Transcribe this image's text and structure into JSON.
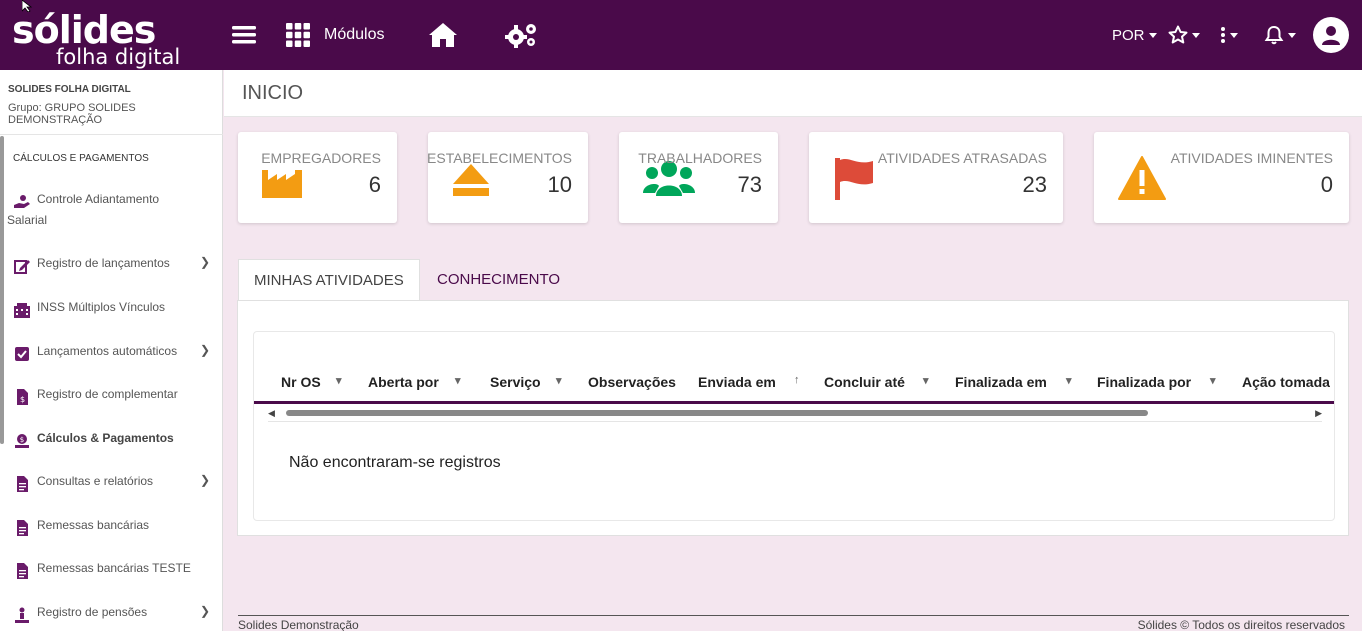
{
  "topbar": {
    "logo_main": "sólides",
    "logo_sub": "folha digital",
    "modules_label": "Módulos",
    "language": "POR"
  },
  "sidebar": {
    "title": "SOLIDES FOLHA DIGITAL",
    "group": "Grupo: GRUPO SOLIDES DEMONSTRAÇÃO",
    "section": "CÁLCULOS E PAGAMENTOS",
    "items": [
      {
        "label": "Controle Adiantamento",
        "label2": "Salarial"
      },
      {
        "label": "Registro de lançamentos"
      },
      {
        "label": "INSS Múltiplos Vínculos"
      },
      {
        "label": "Lançamentos automáticos"
      },
      {
        "label": "Registro de complementar"
      },
      {
        "label": "Cálculos & Pagamentos"
      },
      {
        "label": "Consultas e relatórios"
      },
      {
        "label": "Remessas bancárias"
      },
      {
        "label": "Remessas bancárias TESTE"
      },
      {
        "label": "Registro de pensões"
      }
    ]
  },
  "header": {
    "title": "INICIO"
  },
  "cards": [
    {
      "label": "EMPREGADORES",
      "value": "6",
      "icon": "factory-icon",
      "color": "#f39c12"
    },
    {
      "label": "ESTABELECIMENTOS",
      "value": "10",
      "icon": "eject-icon",
      "color": "#f39c12"
    },
    {
      "label": "TRABALHADORES",
      "value": "73",
      "icon": "users-icon",
      "color": "#00a65a"
    },
    {
      "label": "ATIVIDADES ATRASADAS",
      "value": "23",
      "icon": "flag-icon",
      "color": "#dd4b39"
    },
    {
      "label": "ATIVIDADES IMINENTES",
      "value": "0",
      "icon": "warning-icon",
      "color": "#f39c12"
    }
  ],
  "tabs": [
    {
      "label": "MINHAS ATIVIDADES"
    },
    {
      "label": "CONHECIMENTO"
    }
  ],
  "table": {
    "columns": [
      "Nr OS",
      "Aberta por",
      "Serviço",
      "Observações",
      "Enviada em",
      "Concluir até",
      "Finalizada em",
      "Finalizada por",
      "Ação tomada"
    ],
    "empty_message": "Não encontraram-se registros"
  },
  "footer": {
    "left": "Solides Demonstração",
    "right": "Sólides © Todos os direitos reservados"
  },
  "colors": {
    "brand": "#4a0a4a",
    "background": "#f4e6ef"
  }
}
